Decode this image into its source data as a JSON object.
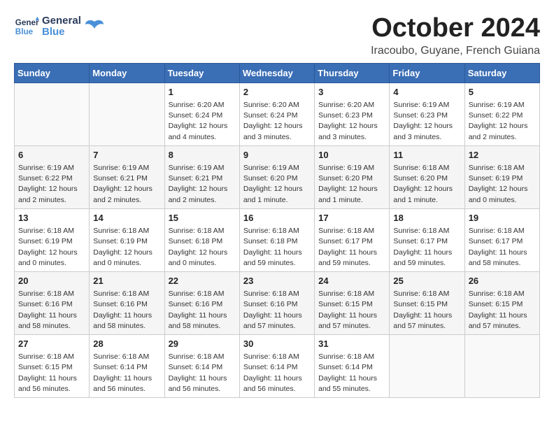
{
  "header": {
    "logo_general": "General",
    "logo_blue": "Blue",
    "title": "October 2024",
    "subtitle": "Iracoubo, Guyane, French Guiana"
  },
  "days_of_week": [
    "Sunday",
    "Monday",
    "Tuesday",
    "Wednesday",
    "Thursday",
    "Friday",
    "Saturday"
  ],
  "weeks": [
    [
      {
        "day": "",
        "info": ""
      },
      {
        "day": "",
        "info": ""
      },
      {
        "day": "1",
        "info": "Sunrise: 6:20 AM\nSunset: 6:24 PM\nDaylight: 12 hours and 4 minutes."
      },
      {
        "day": "2",
        "info": "Sunrise: 6:20 AM\nSunset: 6:24 PM\nDaylight: 12 hours and 3 minutes."
      },
      {
        "day": "3",
        "info": "Sunrise: 6:20 AM\nSunset: 6:23 PM\nDaylight: 12 hours and 3 minutes."
      },
      {
        "day": "4",
        "info": "Sunrise: 6:19 AM\nSunset: 6:23 PM\nDaylight: 12 hours and 3 minutes."
      },
      {
        "day": "5",
        "info": "Sunrise: 6:19 AM\nSunset: 6:22 PM\nDaylight: 12 hours and 2 minutes."
      }
    ],
    [
      {
        "day": "6",
        "info": "Sunrise: 6:19 AM\nSunset: 6:22 PM\nDaylight: 12 hours and 2 minutes."
      },
      {
        "day": "7",
        "info": "Sunrise: 6:19 AM\nSunset: 6:21 PM\nDaylight: 12 hours and 2 minutes."
      },
      {
        "day": "8",
        "info": "Sunrise: 6:19 AM\nSunset: 6:21 PM\nDaylight: 12 hours and 2 minutes."
      },
      {
        "day": "9",
        "info": "Sunrise: 6:19 AM\nSunset: 6:20 PM\nDaylight: 12 hours and 1 minute."
      },
      {
        "day": "10",
        "info": "Sunrise: 6:19 AM\nSunset: 6:20 PM\nDaylight: 12 hours and 1 minute."
      },
      {
        "day": "11",
        "info": "Sunrise: 6:18 AM\nSunset: 6:20 PM\nDaylight: 12 hours and 1 minute."
      },
      {
        "day": "12",
        "info": "Sunrise: 6:18 AM\nSunset: 6:19 PM\nDaylight: 12 hours and 0 minutes."
      }
    ],
    [
      {
        "day": "13",
        "info": "Sunrise: 6:18 AM\nSunset: 6:19 PM\nDaylight: 12 hours and 0 minutes."
      },
      {
        "day": "14",
        "info": "Sunrise: 6:18 AM\nSunset: 6:19 PM\nDaylight: 12 hours and 0 minutes."
      },
      {
        "day": "15",
        "info": "Sunrise: 6:18 AM\nSunset: 6:18 PM\nDaylight: 12 hours and 0 minutes."
      },
      {
        "day": "16",
        "info": "Sunrise: 6:18 AM\nSunset: 6:18 PM\nDaylight: 11 hours and 59 minutes."
      },
      {
        "day": "17",
        "info": "Sunrise: 6:18 AM\nSunset: 6:17 PM\nDaylight: 11 hours and 59 minutes."
      },
      {
        "day": "18",
        "info": "Sunrise: 6:18 AM\nSunset: 6:17 PM\nDaylight: 11 hours and 59 minutes."
      },
      {
        "day": "19",
        "info": "Sunrise: 6:18 AM\nSunset: 6:17 PM\nDaylight: 11 hours and 58 minutes."
      }
    ],
    [
      {
        "day": "20",
        "info": "Sunrise: 6:18 AM\nSunset: 6:16 PM\nDaylight: 11 hours and 58 minutes."
      },
      {
        "day": "21",
        "info": "Sunrise: 6:18 AM\nSunset: 6:16 PM\nDaylight: 11 hours and 58 minutes."
      },
      {
        "day": "22",
        "info": "Sunrise: 6:18 AM\nSunset: 6:16 PM\nDaylight: 11 hours and 58 minutes."
      },
      {
        "day": "23",
        "info": "Sunrise: 6:18 AM\nSunset: 6:16 PM\nDaylight: 11 hours and 57 minutes."
      },
      {
        "day": "24",
        "info": "Sunrise: 6:18 AM\nSunset: 6:15 PM\nDaylight: 11 hours and 57 minutes."
      },
      {
        "day": "25",
        "info": "Sunrise: 6:18 AM\nSunset: 6:15 PM\nDaylight: 11 hours and 57 minutes."
      },
      {
        "day": "26",
        "info": "Sunrise: 6:18 AM\nSunset: 6:15 PM\nDaylight: 11 hours and 57 minutes."
      }
    ],
    [
      {
        "day": "27",
        "info": "Sunrise: 6:18 AM\nSunset: 6:15 PM\nDaylight: 11 hours and 56 minutes."
      },
      {
        "day": "28",
        "info": "Sunrise: 6:18 AM\nSunset: 6:14 PM\nDaylight: 11 hours and 56 minutes."
      },
      {
        "day": "29",
        "info": "Sunrise: 6:18 AM\nSunset: 6:14 PM\nDaylight: 11 hours and 56 minutes."
      },
      {
        "day": "30",
        "info": "Sunrise: 6:18 AM\nSunset: 6:14 PM\nDaylight: 11 hours and 56 minutes."
      },
      {
        "day": "31",
        "info": "Sunrise: 6:18 AM\nSunset: 6:14 PM\nDaylight: 11 hours and 55 minutes."
      },
      {
        "day": "",
        "info": ""
      },
      {
        "day": "",
        "info": ""
      }
    ]
  ]
}
